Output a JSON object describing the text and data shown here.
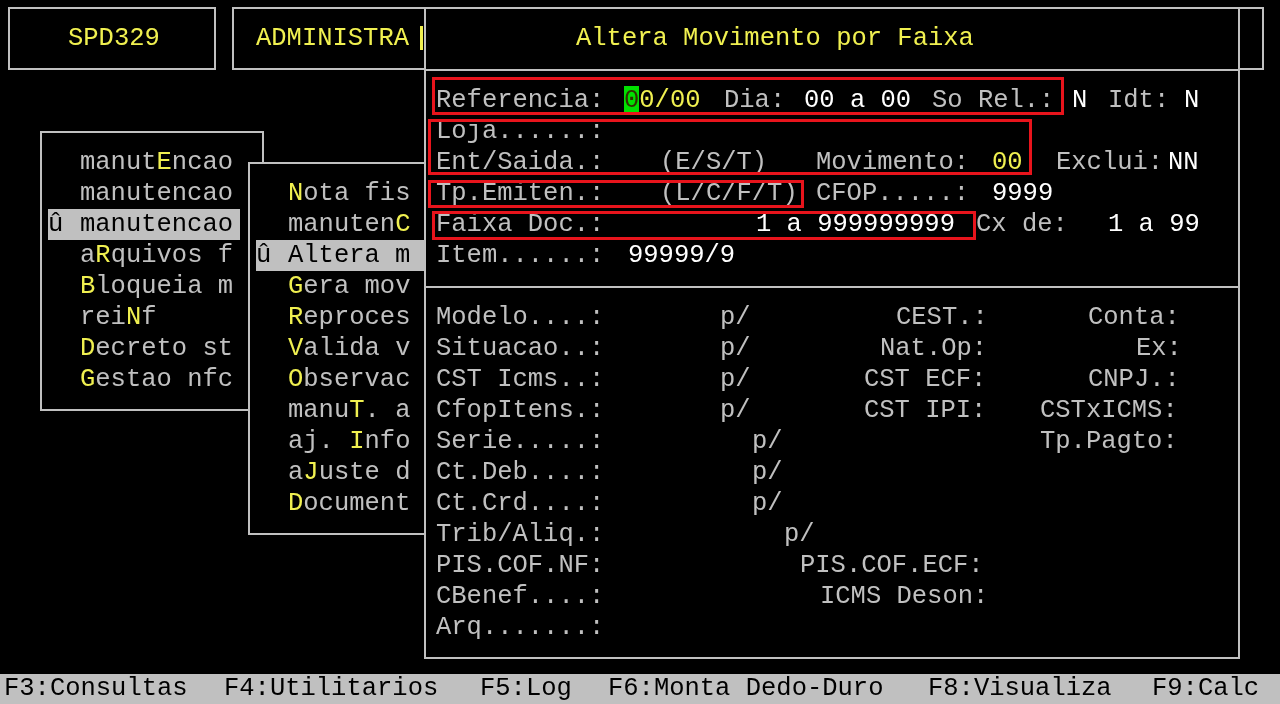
{
  "header_boxes": [
    {
      "text": "SPD329"
    },
    {
      "text": "ADMINISTRA"
    }
  ],
  "menus": [
    {
      "items": [
        {
          "parts": [
            {
              "text": "manut",
              "hotkey": false
            },
            {
              "text": "E",
              "hotkey": true
            },
            {
              "text": "ncao",
              "hotkey": false
            }
          ],
          "selected": false
        },
        {
          "parts": [
            {
              "text": "manutencao",
              "hotkey": false
            }
          ],
          "selected": false
        },
        {
          "prefix": "û",
          "parts": [
            {
              "text": "manutencao",
              "hotkey": false
            }
          ],
          "selected": true
        },
        {
          "parts": [
            {
              "text": "a",
              "hotkey": false
            },
            {
              "text": "R",
              "hotkey": true
            },
            {
              "text": "quivos f",
              "hotkey": false
            }
          ],
          "selected": false
        },
        {
          "parts": [
            {
              "text": "B",
              "hotkey": true
            },
            {
              "text": "loqueia m",
              "hotkey": false
            }
          ],
          "selected": false
        },
        {
          "parts": [
            {
              "text": "rei",
              "hotkey": false
            },
            {
              "text": "N",
              "hotkey": true
            },
            {
              "text": "f",
              "hotkey": false
            }
          ],
          "selected": false
        },
        {
          "parts": [
            {
              "text": "D",
              "hotkey": true
            },
            {
              "text": "ecreto st",
              "hotkey": false
            }
          ],
          "selected": false
        },
        {
          "parts": [
            {
              "text": "G",
              "hotkey": true
            },
            {
              "text": "estao nfc",
              "hotkey": false
            }
          ],
          "selected": false
        }
      ]
    },
    {
      "items": [
        {
          "parts": [
            {
              "text": "N",
              "hotkey": true
            },
            {
              "text": "ota fis",
              "hotkey": false
            }
          ],
          "selected": false
        },
        {
          "parts": [
            {
              "text": "manuten",
              "hotkey": false
            },
            {
              "text": "C",
              "hotkey": true
            }
          ],
          "selected": false
        },
        {
          "prefix": "û",
          "parts": [
            {
              "text": "Altera m",
              "hotkey": false
            }
          ],
          "selected": true
        },
        {
          "parts": [
            {
              "text": "G",
              "hotkey": true
            },
            {
              "text": "era mov",
              "hotkey": false
            }
          ],
          "selected": false
        },
        {
          "parts": [
            {
              "text": "R",
              "hotkey": true
            },
            {
              "text": "eproces",
              "hotkey": false
            }
          ],
          "selected": false
        },
        {
          "parts": [
            {
              "text": "V",
              "hotkey": true
            },
            {
              "text": "alida v",
              "hotkey": false
            }
          ],
          "selected": false
        },
        {
          "parts": [
            {
              "text": "O",
              "hotkey": true
            },
            {
              "text": "bservac",
              "hotkey": false
            }
          ],
          "selected": false
        },
        {
          "parts": [
            {
              "text": "manu",
              "hotkey": false
            },
            {
              "text": "T",
              "hotkey": true
            },
            {
              "text": ". a",
              "hotkey": false
            }
          ],
          "selected": false
        },
        {
          "parts": [
            {
              "text": "aj. ",
              "hotkey": false
            },
            {
              "text": "I",
              "hotkey": true
            },
            {
              "text": "nfo",
              "hotkey": false
            }
          ],
          "selected": false
        },
        {
          "parts": [
            {
              "text": "a",
              "hotkey": false
            },
            {
              "text": "J",
              "hotkey": true
            },
            {
              "text": "uste d",
              "hotkey": false
            }
          ],
          "selected": false
        },
        {
          "parts": [
            {
              "text": "D",
              "hotkey": true
            },
            {
              "text": "ocument",
              "hotkey": false
            }
          ],
          "selected": false
        }
      ]
    }
  ],
  "dialog": {
    "title": "Altera Movimento por Faixa",
    "top_rows": [
      [
        {
          "text": "Referencia:",
          "kind": "label"
        },
        {
          "text": "00/00",
          "kind": "input",
          "cursor": true
        },
        {
          "text": "Dia:",
          "kind": "label"
        },
        {
          "text": "00 a 00",
          "kind": "value"
        },
        {
          "text": "So Rel.:",
          "kind": "label"
        },
        {
          "text": "N",
          "kind": "value"
        },
        {
          "text": "Idt:",
          "kind": "label"
        },
        {
          "text": "N",
          "kind": "value"
        }
      ],
      [
        {
          "text": "Loja......:",
          "kind": "label"
        }
      ],
      [
        {
          "text": "Ent/Saida.:",
          "kind": "label"
        },
        {
          "text": "(E/S/T)",
          "kind": "label"
        },
        {
          "text": "Movimento:",
          "kind": "label"
        },
        {
          "text": "00",
          "kind": "input",
          "cursor": false
        },
        {
          "text": "Exclui:",
          "kind": "label"
        },
        {
          "text": "NN",
          "kind": "value"
        }
      ],
      [
        {
          "text": "Tp.Emiten.:",
          "kind": "label"
        },
        {
          "text": "(L/C/F/T)",
          "kind": "label"
        },
        {
          "text": "CFOP.....:",
          "kind": "label"
        },
        {
          "text": "9999",
          "kind": "value"
        }
      ],
      [
        {
          "text": "Faixa Doc.:",
          "kind": "label"
        },
        {
          "text": "1 a 999999999",
          "kind": "value"
        },
        {
          "text": "Cx de:",
          "kind": "label"
        },
        {
          "text": "1 a 99",
          "kind": "value"
        }
      ],
      [
        {
          "text": "Item......:",
          "kind": "label"
        },
        {
          "text": "99999/9",
          "kind": "value"
        }
      ]
    ],
    "highlight_frames": [
      {
        "kind": "outline"
      },
      {
        "kind": "outline"
      },
      {
        "kind": "outline"
      },
      {
        "kind": "outline"
      }
    ],
    "bottom_rows": [
      [
        {
          "text": "Modelo....:",
          "kind": "label"
        },
        {
          "text": "p/",
          "kind": "label"
        },
        {
          "text": "CEST.:",
          "kind": "label"
        },
        {
          "text": "Conta:",
          "kind": "label"
        }
      ],
      [
        {
          "text": "Situacao..:",
          "kind": "label"
        },
        {
          "text": "p/",
          "kind": "label"
        },
        {
          "text": "Nat.Op:",
          "kind": "label"
        },
        {
          "text": "Ex:",
          "kind": "label"
        }
      ],
      [
        {
          "text": "CST Icms..:",
          "kind": "label"
        },
        {
          "text": "p/",
          "kind": "label"
        },
        {
          "text": "CST ECF:",
          "kind": "label"
        },
        {
          "text": "CNPJ.:",
          "kind": "label"
        }
      ],
      [
        {
          "text": "CfopItens.:",
          "kind": "label"
        },
        {
          "text": "p/",
          "kind": "label"
        },
        {
          "text": "CST IPI:",
          "kind": "label"
        },
        {
          "text": "CSTxICMS:",
          "kind": "label"
        }
      ],
      [
        {
          "text": "Serie.....:",
          "kind": "label"
        },
        {
          "text": "p/",
          "kind": "label"
        },
        {
          "text": "Tp.Pagto:",
          "kind": "label"
        }
      ],
      [
        {
          "text": "Ct.Deb....:",
          "kind": "label"
        },
        {
          "text": "p/",
          "kind": "label"
        }
      ],
      [
        {
          "text": "Ct.Crd....:",
          "kind": "label"
        },
        {
          "text": "p/",
          "kind": "label"
        }
      ],
      [
        {
          "text": "Trib/Aliq.:",
          "kind": "label"
        },
        {
          "text": "p/",
          "kind": "label"
        }
      ],
      [
        {
          "text": "PIS.COF.NF:",
          "kind": "label"
        },
        {
          "text": "PIS.COF.ECF:",
          "kind": "label"
        }
      ],
      [
        {
          "text": "CBenef....:",
          "kind": "label"
        },
        {
          "text": "ICMS Deson:",
          "kind": "label"
        }
      ],
      [
        {
          "text": "Arq.......:",
          "kind": "label"
        }
      ]
    ]
  },
  "status_bar": {
    "keys": [
      {
        "text": "F3:Consultas"
      },
      {
        "text": "F4:Utilitarios"
      },
      {
        "text": "F5:Log"
      },
      {
        "text": "F6:Monta Dedo-Duro"
      },
      {
        "text": "F8:Visualiza"
      },
      {
        "text": "F9:Calc"
      }
    ]
  }
}
